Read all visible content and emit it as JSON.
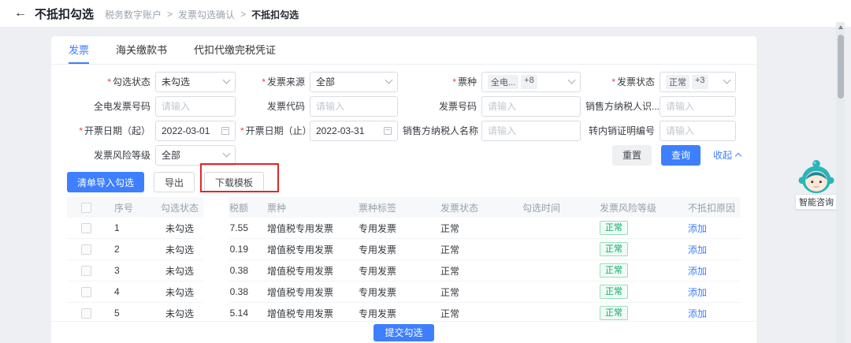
{
  "colors": {
    "accent_blue": "#3d7fff",
    "annotation_red": "#e2262a",
    "risk_badge_green": "#0bab67"
  },
  "topbar": {
    "back_icon": "←",
    "title": "不抵扣勾选",
    "separator": ">",
    "breadcrumb": [
      "税务数字账户",
      "发票勾选确认",
      "不抵扣勾选"
    ]
  },
  "tabs": {
    "invoice": "发票",
    "customs": "海关缴款书",
    "withholding": "代扣代缴完税凭证"
  },
  "filters": {
    "required_mark": "*",
    "check_status": {
      "label": "勾选状态",
      "value": "未勾选"
    },
    "invoice_source": {
      "label": "发票来源",
      "value": "全部"
    },
    "ticket_type": {
      "label": "票种",
      "tag1": "全电...",
      "tag2": "+8"
    },
    "invoice_status": {
      "label": "发票状态",
      "tag1": "正常",
      "tag2": "+3"
    },
    "digital_invoice_no": {
      "label": "全电发票号码",
      "placeholder": "请输入"
    },
    "invoice_code": {
      "label": "发票代码",
      "placeholder": "请输入"
    },
    "invoice_no": {
      "label": "发票号码",
      "placeholder": "请输入"
    },
    "seller_tax_no": {
      "label": "销售方纳税人识...",
      "placeholder": "请输入"
    },
    "date_start": {
      "label": "开票日期（起）",
      "value": "2022-03-01"
    },
    "date_end": {
      "label": "开票日期（止）",
      "value": "2022-03-31"
    },
    "seller_name": {
      "label": "销售方纳税人名称",
      "placeholder": "请输入"
    },
    "transfer_cert_no": {
      "label": "转内销证明编号",
      "placeholder": "请输入"
    },
    "risk_level": {
      "label": "发票风险等级",
      "value": "全部"
    },
    "reset": "重置",
    "query": "查询",
    "collapse": "收起"
  },
  "actions": {
    "import_checked": "清单导入勾选",
    "export": "导出",
    "download_template": "下载模板"
  },
  "table": {
    "columns": [
      "序号",
      "勾选状态",
      "税额",
      "票种",
      "票种标签",
      "发票状态",
      "勾选时间",
      "发票风险等级",
      "不抵扣原因"
    ],
    "rows": [
      {
        "seq": "1",
        "check_status": "未勾选",
        "amount": "7.55",
        "kind": "增值税专用发票",
        "kind_tag": "专用发票",
        "invoice_status": "正常",
        "check_time": "",
        "risk": "正常",
        "reason_action": "添加"
      },
      {
        "seq": "2",
        "check_status": "未勾选",
        "amount": "0.19",
        "kind": "增值税专用发票",
        "kind_tag": "专用发票",
        "invoice_status": "正常",
        "check_time": "",
        "risk": "正常",
        "reason_action": "添加"
      },
      {
        "seq": "3",
        "check_status": "未勾选",
        "amount": "0.38",
        "kind": "增值税专用发票",
        "kind_tag": "专用发票",
        "invoice_status": "正常",
        "check_time": "",
        "risk": "正常",
        "reason_action": "添加"
      },
      {
        "seq": "4",
        "check_status": "未勾选",
        "amount": "0.38",
        "kind": "增值税专用发票",
        "kind_tag": "专用发票",
        "invoice_status": "正常",
        "check_time": "",
        "risk": "正常",
        "reason_action": "添加"
      },
      {
        "seq": "5",
        "check_status": "未勾选",
        "amount": "5.14",
        "kind": "增值税专用发票",
        "kind_tag": "专用发票",
        "invoice_status": "正常",
        "check_time": "",
        "risk": "正常",
        "reason_action": "添加"
      }
    ]
  },
  "footer": {
    "submit": "提交勾选"
  },
  "assistant": {
    "label": "智能咨询"
  }
}
